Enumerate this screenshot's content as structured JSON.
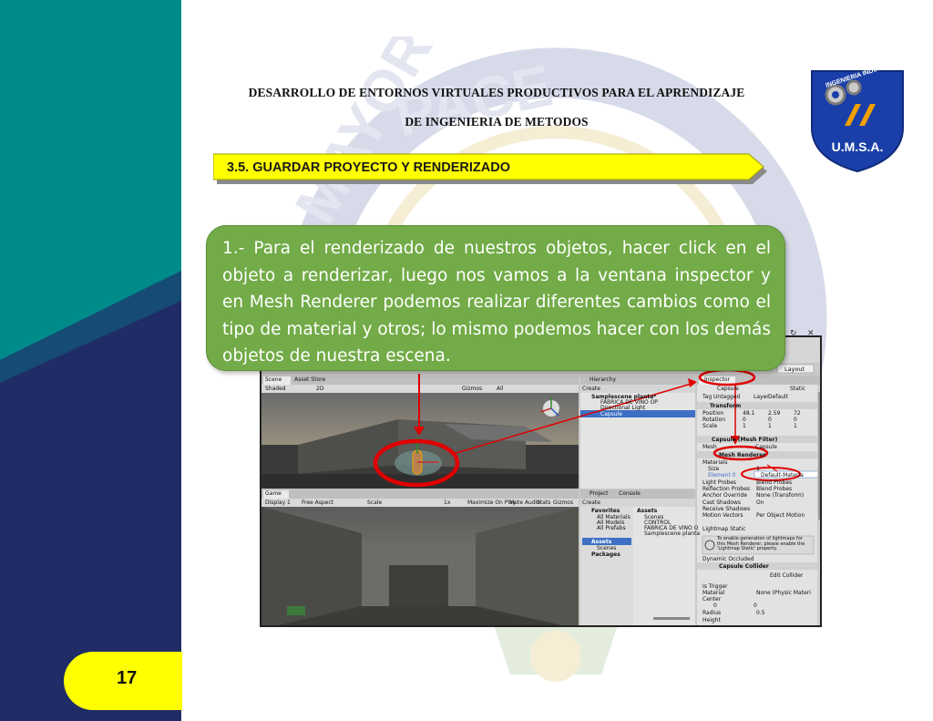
{
  "header": {
    "title_line1": "DESARROLLO DE ENTORNOS VIRTUALES PRODUCTIVOS PARA EL APRENDIZAJE",
    "title_line2": "DE INGENIERIA DE METODOS"
  },
  "logo": {
    "ring_text": "INGENIERIA INDUSTRIAL",
    "caption": "U.M.S.A."
  },
  "section": {
    "label": "3.5. GUARDAR PROYECTO Y RENDERIZADO"
  },
  "callout": {
    "text": "1.- Para el renderizado de nuestros objetos, hacer click en el objeto a renderizar, luego nos vamos a la ventana inspector y en Mesh Renderer podemos realizar diferentes cambios como el tipo de material y otros; lo mismo podemos hacer con los demás objetos de nuestra escena."
  },
  "unity": {
    "scene_tab": "Scene",
    "asset_store_tab": "Asset Store",
    "shaded": "Shaded",
    "twod": "2D",
    "gizmos": "Gizmos",
    "search_all": "All",
    "layout": "Layout",
    "hierarchy_tab": "Hierarchy",
    "create": "Create",
    "hierarchy_root": "Samplescene planta*",
    "hierarchy_items": [
      "FABRICA DE VINO OP",
      "Directional Light",
      "Capsule"
    ],
    "game_tab": "Game",
    "display": "Display 1",
    "free_aspect": "Free Aspect",
    "scale": "Scale",
    "scale_value": "1x",
    "maximize": "Maximize On Play",
    "mute": "Mute Audio",
    "stats": "Stats",
    "gizmos2": "Gizmos",
    "project_tab": "Project",
    "console_tab": "Console",
    "favorites": "Favorites",
    "fav_items": [
      "All Materials",
      "All Models",
      "All Prefabs"
    ],
    "assets": "Assets",
    "asset_tree": [
      "Scenes"
    ],
    "packages": "Packages",
    "assets_title": "Assets",
    "asset_items": [
      "Scenes",
      "CONTROL",
      "FABRICA DE VINO O",
      "Samplescene planta"
    ],
    "inspector_tab": "Inspector",
    "object_name": "Capsule",
    "static": "Static",
    "tag_label": "Tag",
    "tag_value": "Untagged",
    "layer_label": "Layer",
    "layer_value": "Default",
    "transform": "Transform",
    "position": "Position",
    "rotation": "Rotation",
    "scale_row": "Scale",
    "pos": [
      "48.1",
      "2.59",
      "72"
    ],
    "rot": [
      "0",
      "0",
      "0"
    ],
    "scl": [
      "1",
      "1",
      "1"
    ],
    "mesh_filter": "Capsule (Mesh Filter)",
    "mesh_label": "Mesh",
    "mesh_value": "Capsule",
    "mesh_renderer": "Mesh Renderer",
    "materials": "Materials",
    "size_label": "Size",
    "size_value": "1",
    "element0": "Element 0",
    "element0_value": "Default-Materia",
    "light_probes": "Light Probes",
    "light_probes_value": "Blend Probes",
    "reflection_probes": "Reflection Probes",
    "reflection_probes_value": "Blend Probes",
    "anchor_override": "Anchor Override",
    "anchor_value": "None (Transform)",
    "cast_shadows": "Cast Shadows",
    "cast_value": "On",
    "receive_shadows": "Receive Shadows",
    "motion_vectors": "Motion Vectors",
    "motion_value": "Per Object Motion",
    "lightmap_static": "Lightmap Static",
    "info_text": "To enable generation of lightmaps for this Mesh Renderer, please enable the 'Lightmap Static' property.",
    "dynamic_occluded": "Dynamic Occluded",
    "capsule_collider": "Capsule Collider",
    "edit_collider": "Edit Collider",
    "is_trigger": "Is Trigger",
    "material_label": "Material",
    "material_value": "None (Physic Materi",
    "center": "Center",
    "center_x": "0",
    "center_y": "0",
    "radius": "Radius",
    "radius_value": "0.5",
    "height": "Height"
  },
  "page": {
    "number": "17"
  },
  "colors": {
    "teal": "#008b8b",
    "navy": "#1f2c66",
    "callout_green": "#72ab47",
    "banner_yellow": "#ffff00",
    "highlight_red": "#e00000"
  }
}
